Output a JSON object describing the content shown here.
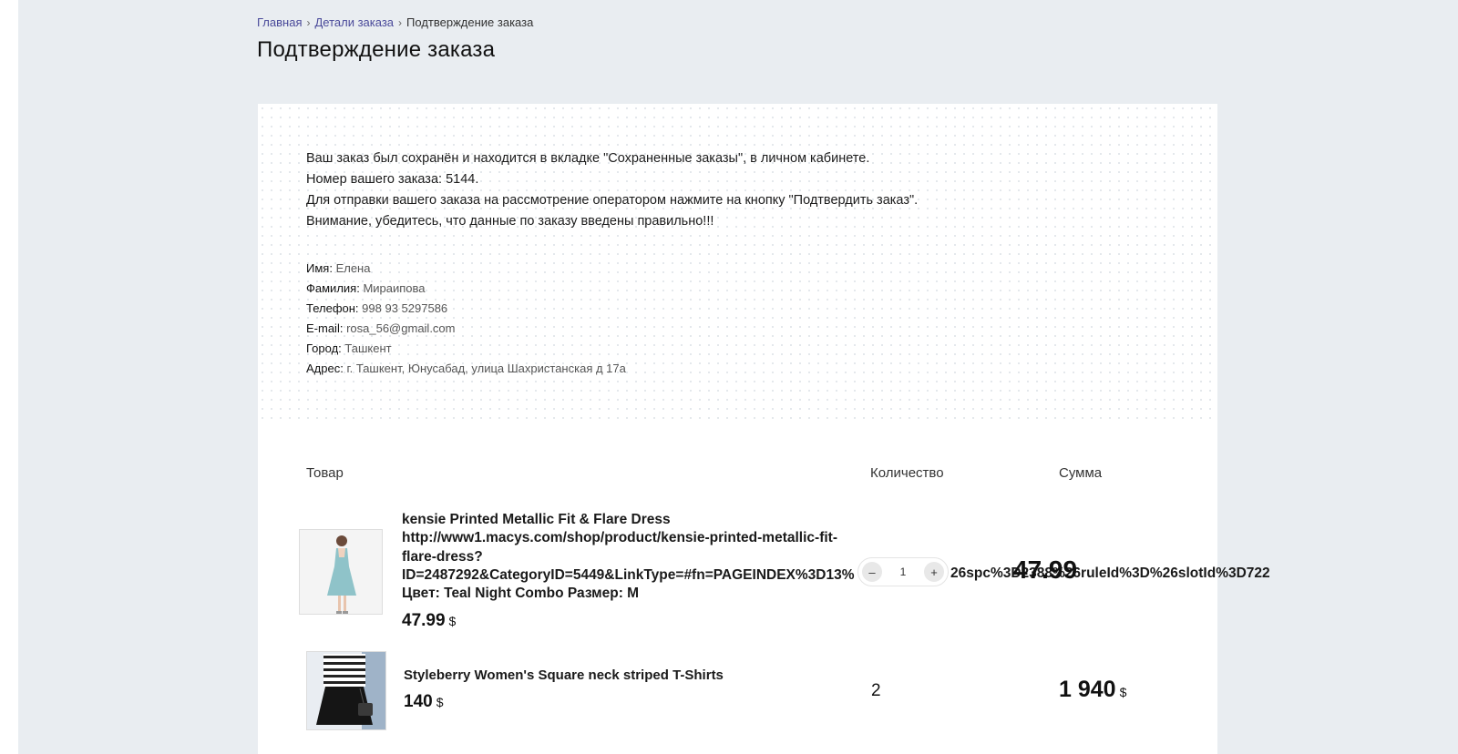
{
  "breadcrumb": {
    "home": "Главная",
    "sep": "›",
    "order_details": "Детали заказа",
    "current": "Подтверждение заказа"
  },
  "page_title": "Подтверждение заказа",
  "notice": {
    "line1": "Ваш заказ был сохранён и находится в вкладке \"Сохраненные заказы\", в личном кабинете.",
    "line2": "Номер вашего заказа: 5144.",
    "line3": "Для отправки вашего заказа на рассмотрение оператором нажмите на кнопку \"Подтвердить заказ\".",
    "line4": "Внимание, убедитесь, что данные по заказу введены правильно!!!"
  },
  "customer": [
    {
      "label": "Имя:",
      "value": "Елена"
    },
    {
      "label": "Фамилия:",
      "value": "Мираипова"
    },
    {
      "label": "Телефон:",
      "value": "998 93 5297586"
    },
    {
      "label": "E-mail:",
      "value": "rosa_56@gmail.com"
    },
    {
      "label": "Город:",
      "value": "Ташкент"
    },
    {
      "label": "Адрес:",
      "value": "г. Ташкент, Юнусабад, улица Шахристанская д 17а"
    }
  ],
  "table": {
    "col_product": "Товар",
    "col_quantity": "Количество",
    "col_sum": "Сумма"
  },
  "items": [
    {
      "title_lines": [
        "kensie Printed Metallic Fit & Flare Dress",
        "http://www1.macys.com/shop/product/kensie-printed-metallic-fit-",
        "flare-dress?",
        "ID=2487292&CategoryID=5449&LinkType=#fn=PAGEINDEX%3D13%",
        "Цвет: Teal Night Combo Размер: M"
      ],
      "url_tail": "26spc%3D2388%26ruleId%3D%26slotId%3D722",
      "price": "47.99",
      "currency": "$",
      "quantity": "1",
      "minus": "–",
      "plus": "+",
      "sum": "47.99",
      "image_icon": "dress-photo-icon"
    },
    {
      "title": "Styleberry Women's Square neck striped T-Shirts",
      "price": "140",
      "currency": "$",
      "quantity": "2",
      "sum": "1 940",
      "image_icon": "striped-shirt-photo-icon"
    }
  ],
  "colors": {
    "page_bg": "#e9edf1",
    "card_bg": "#ffffff",
    "link": "#4a4a9a",
    "text": "#1a1a1a",
    "dress_teal": "#8fc3c9"
  }
}
